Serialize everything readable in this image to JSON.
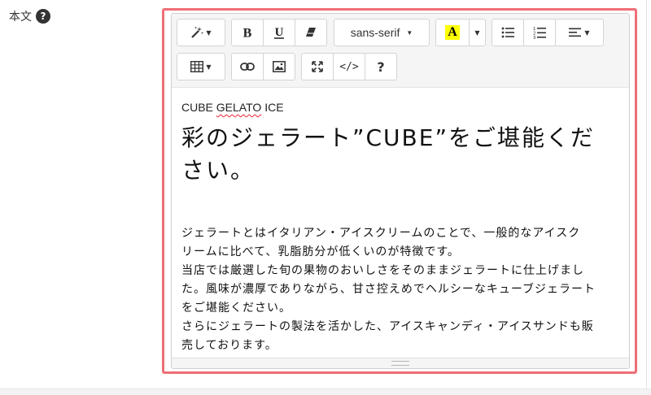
{
  "field": {
    "label": "本文",
    "help_glyph": "?"
  },
  "toolbar": {
    "font_name": "sans-serif",
    "highlight_letter": "A",
    "highlight_color": "#ffff00",
    "code_view": "</>",
    "help": "?"
  },
  "icons": [
    "magic-icon",
    "bold-icon",
    "underline-icon",
    "eraser-icon",
    "text-color-icon",
    "bullet-list-icon",
    "numbered-list-icon",
    "align-icon",
    "table-icon",
    "link-icon",
    "picture-icon",
    "fullscreen-icon",
    "code-view-icon",
    "help-icon"
  ],
  "accent_color": "#ee6f76",
  "content": {
    "subtitle_pre": "CUBE ",
    "subtitle_misspelt": "GELATO",
    "subtitle_post": " ICE",
    "headline_1": "彩のジェラート”CUBE”をご堪能くだ",
    "headline_2": "さい。",
    "paragraph_lines": [
      "ジェラートとはイタリアン・アイスクリームのことで、一般的なアイスク",
      "リームに比べて、乳脂肪分が低くいのが特徴です。",
      "当店では厳選した旬の果物のおいしさをそのままジェラートに仕上げまし",
      "た。風味が濃厚でありながら、甘さ控えめでヘルシーなキューブジェラート",
      "をご堪能ください。",
      "さらにジェラートの製法を活かした、アイスキャンディ・アイスサンドも販",
      "売しております。"
    ]
  }
}
